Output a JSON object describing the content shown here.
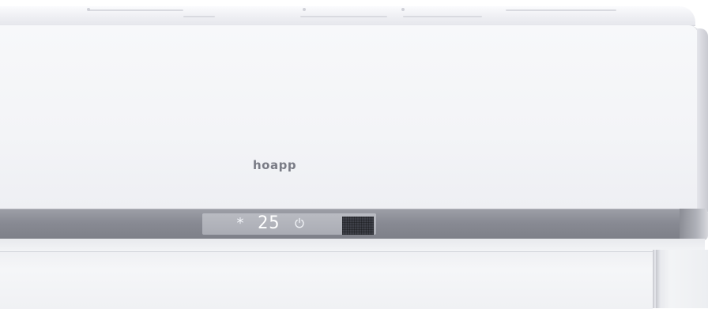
{
  "brand": {
    "logo_text": "hoapp"
  },
  "display": {
    "mode_icon": "snowflake-icon",
    "mode_glyph": "*",
    "temperature": "25",
    "power_icon": "power-icon"
  },
  "colors": {
    "body": "#f4f5f8",
    "display_band": "#8a8c94",
    "display_text": "#ffffff",
    "sensor": "#3e4048"
  }
}
